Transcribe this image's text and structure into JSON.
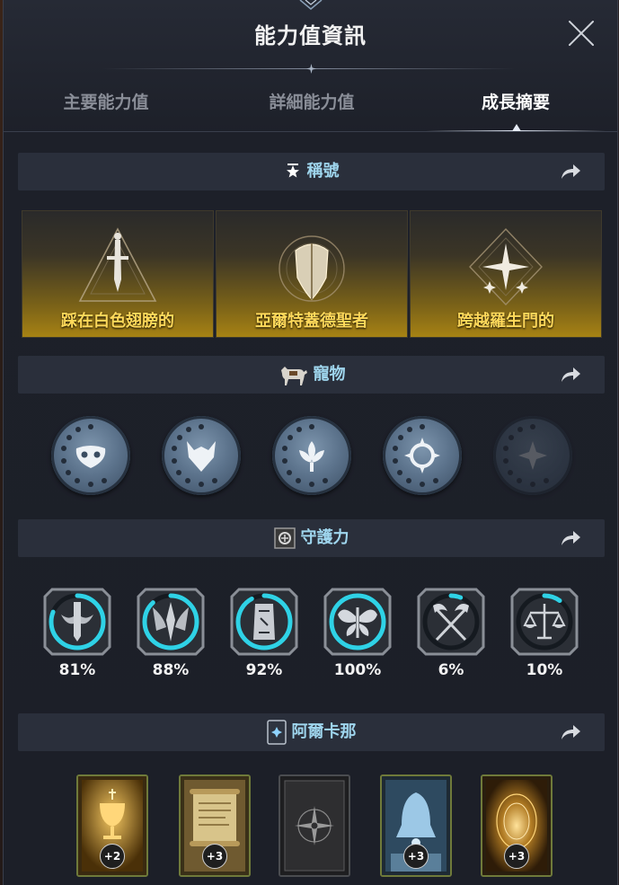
{
  "window": {
    "title": "能力值資訊"
  },
  "tabs": [
    {
      "label": "主要能力值",
      "active": false
    },
    {
      "label": "詳細能力值",
      "active": false
    },
    {
      "label": "成長摘要",
      "active": true
    }
  ],
  "sections": {
    "titles": {
      "label": "稱號",
      "icon": "star-icon",
      "items": [
        {
          "name": "踩在白色翅膀的",
          "icon": "sword-triangle-emblem-icon"
        },
        {
          "name": "亞爾特蓋德聖者",
          "icon": "shield-emblem-icon"
        },
        {
          "name": "跨越羅生門的",
          "icon": "star-diamond-emblem-icon"
        }
      ]
    },
    "pets": {
      "label": "寵物",
      "icon": "horse-icon",
      "items": [
        {
          "icon": "owl-pet-icon",
          "locked": false
        },
        {
          "icon": "wolf-pet-icon",
          "locked": false
        },
        {
          "icon": "lotus-pet-icon",
          "locked": false
        },
        {
          "icon": "sun-pet-icon",
          "locked": false
        },
        {
          "icon": "flower-pet-icon",
          "locked": true
        }
      ]
    },
    "guardians": {
      "label": "守護力",
      "icon": "guardian-emblem-icon",
      "items": [
        {
          "percent": "81%",
          "value": 0.81,
          "icon": "sword-wings-icon"
        },
        {
          "percent": "88%",
          "value": 0.88,
          "icon": "winged-blade-icon"
        },
        {
          "percent": "92%",
          "value": 0.92,
          "icon": "rune-stone-icon"
        },
        {
          "percent": "100%",
          "value": 1.0,
          "icon": "butterfly-icon"
        },
        {
          "percent": "6%",
          "value": 0.06,
          "icon": "crossed-scythes-icon"
        },
        {
          "percent": "10%",
          "value": 0.1,
          "icon": "scales-icon"
        }
      ]
    },
    "arcana": {
      "label": "阿爾卡那",
      "icon": "card-icon",
      "items": [
        {
          "level": "+2",
          "art": "golden-chalice-card"
        },
        {
          "level": "+3",
          "art": "scroll-card"
        },
        {
          "level": "",
          "art": "compass-card-back"
        },
        {
          "level": "+3",
          "art": "frozen-bell-card"
        },
        {
          "level": "+3",
          "art": "golden-portal-card"
        }
      ]
    }
  },
  "colors": {
    "section_title": "#9fd6ee",
    "title_name": "#ffd95a",
    "progress_ring": "#2fd2e6",
    "card_frame": "#6f7a3a"
  }
}
